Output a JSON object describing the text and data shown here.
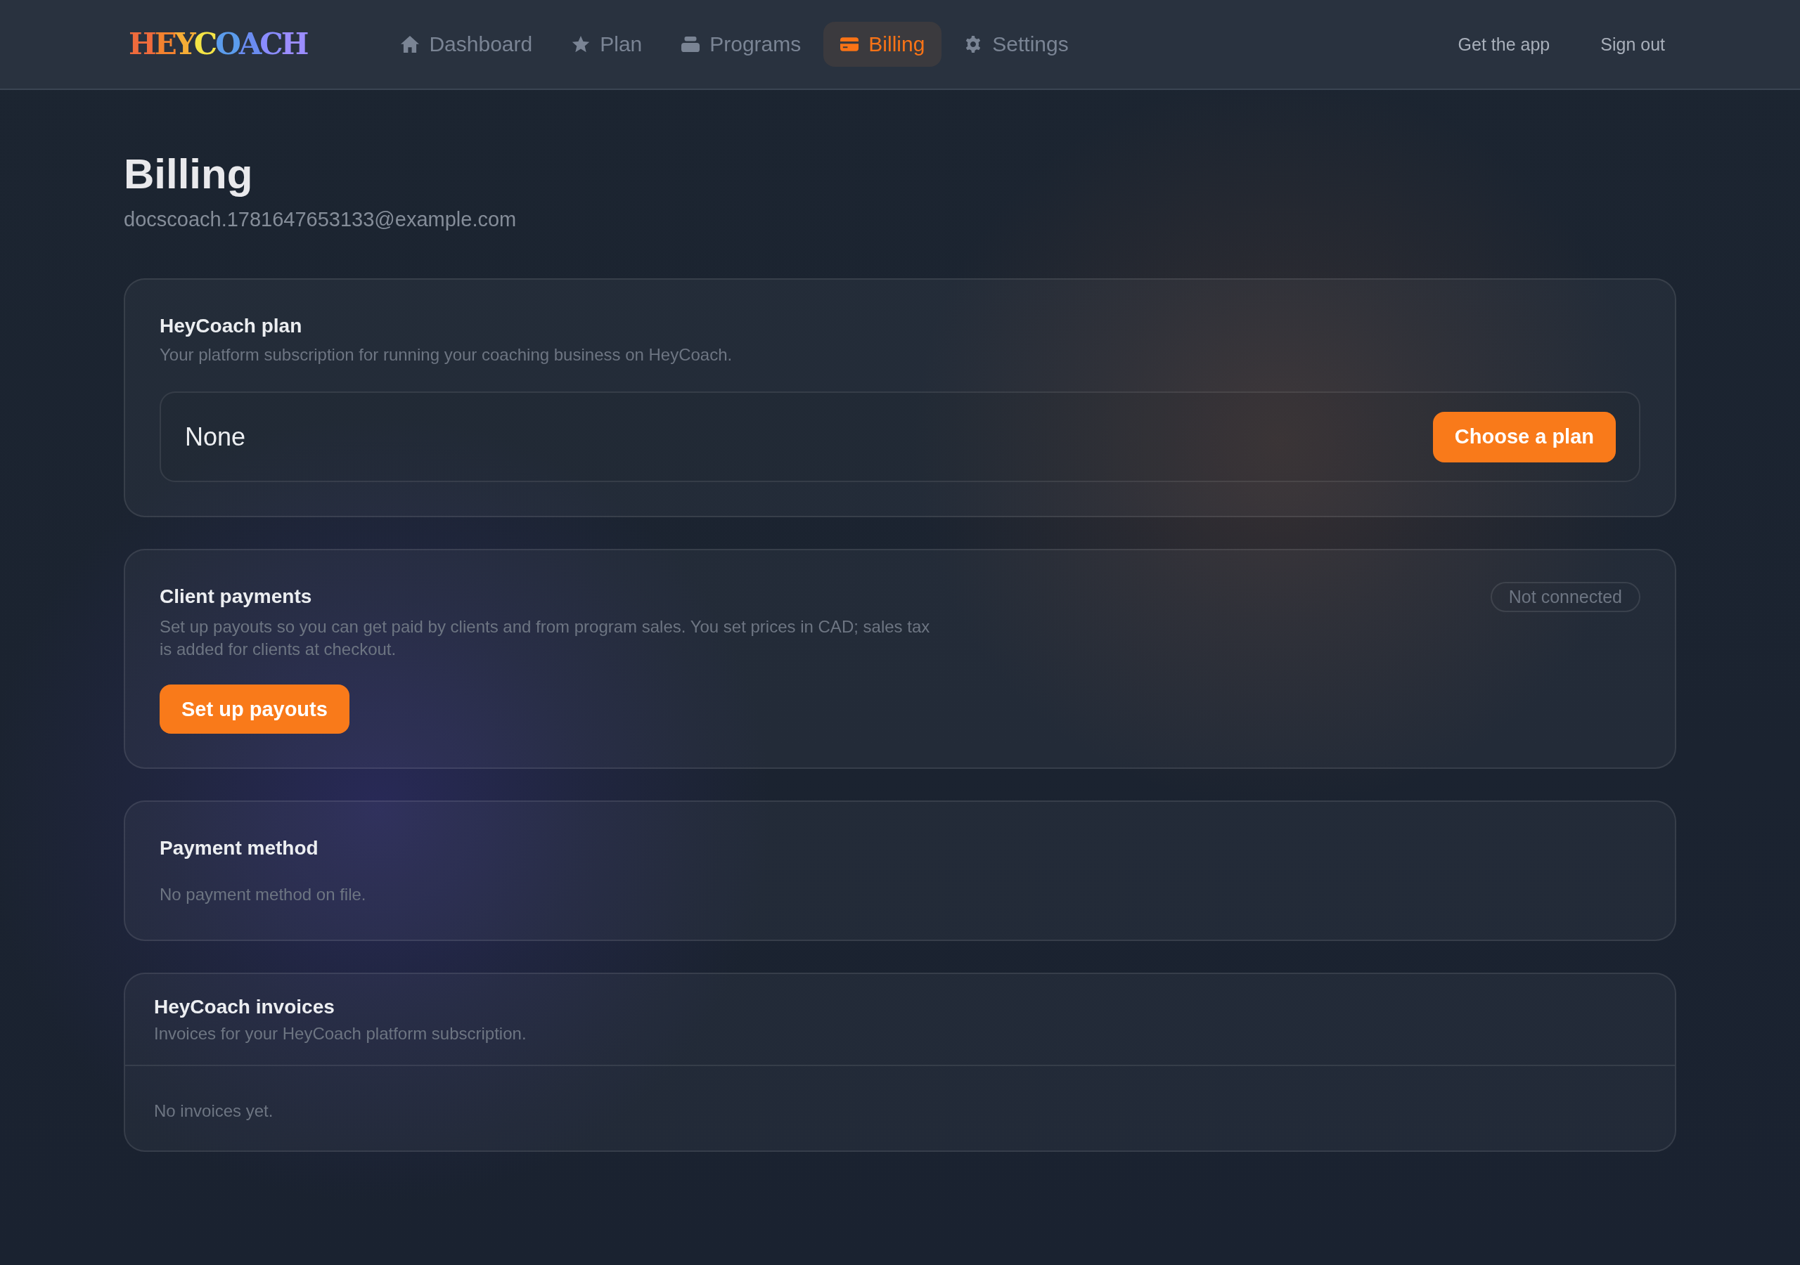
{
  "brand": {
    "logo": "HEYCOACH"
  },
  "nav": {
    "tabs": [
      {
        "label": "Dashboard",
        "selected": false
      },
      {
        "label": "Plan",
        "selected": false
      },
      {
        "label": "Programs",
        "selected": false
      },
      {
        "label": "Billing",
        "selected": true
      },
      {
        "label": "Settings",
        "selected": false
      }
    ],
    "links": [
      "Get the app",
      "Sign out"
    ]
  },
  "page": {
    "title": "Billing",
    "email": "docscoach.1781647653133@example.com"
  },
  "plan_card": {
    "title": "HeyCoach plan",
    "description": "Your platform subscription for running your coaching business on HeyCoach.",
    "current_plan": "None",
    "button": "Choose a plan"
  },
  "client_payments": {
    "title": "Client payments",
    "status": "Not connected",
    "description": "Set up payouts so you can get paid by clients and from program sales. You set prices in CAD; sales tax is added for clients at checkout.",
    "button": "Set up payouts"
  },
  "payment_method": {
    "title": "Payment method",
    "empty_text": "No payment method on file."
  },
  "invoices": {
    "title": "HeyCoach invoices",
    "description": "Invoices for your HeyCoach platform subscription.",
    "empty_text": "No invoices yet."
  }
}
